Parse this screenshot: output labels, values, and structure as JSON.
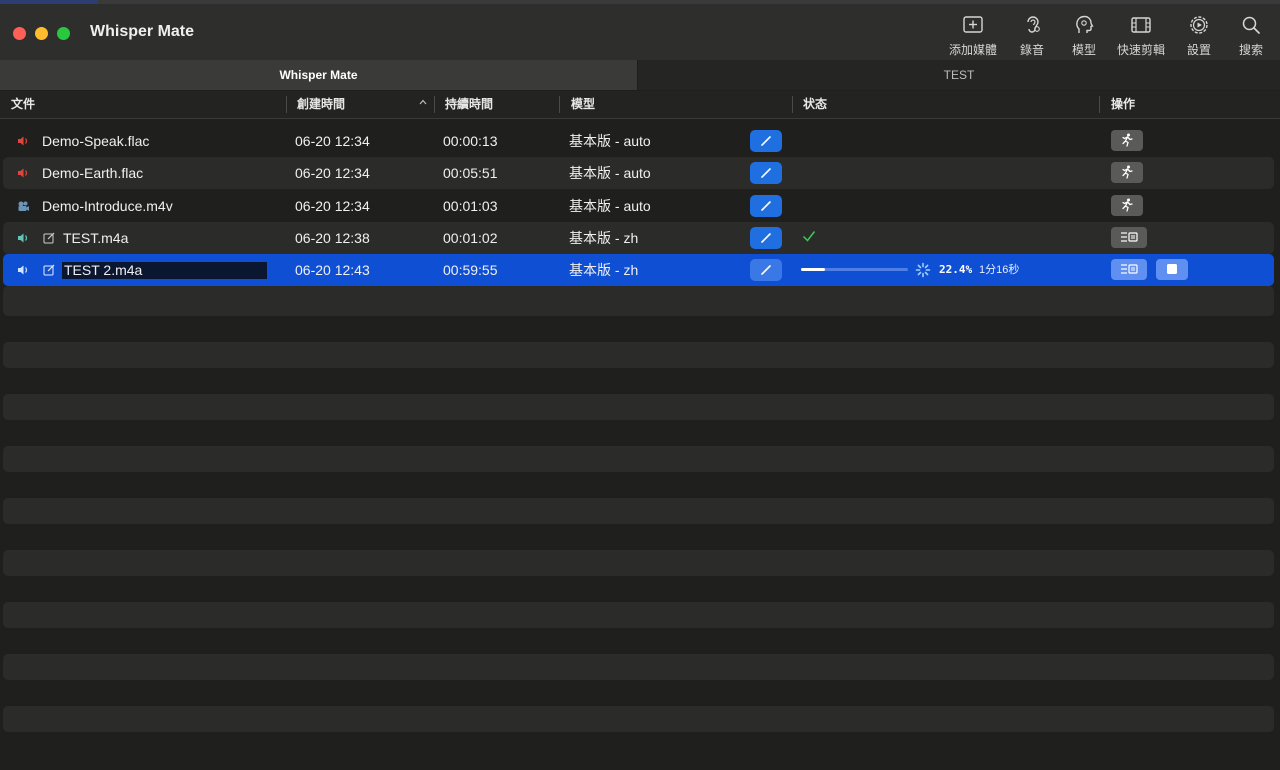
{
  "window": {
    "title": "Whisper Mate"
  },
  "toolbar": {
    "add_media": "添加媒體",
    "record": "錄音",
    "model": "模型",
    "quick_edit": "快速剪輯",
    "settings": "設置",
    "search": "搜索"
  },
  "tabs": [
    {
      "label": "Whisper Mate",
      "active": true
    },
    {
      "label": "TEST",
      "active": false
    }
  ],
  "columns": {
    "file": "文件",
    "created": "創建時間",
    "duration": "持續時間",
    "model": "模型",
    "status": "状态",
    "actions": "操作"
  },
  "rows": [
    {
      "icon": "audio-file-red-icon",
      "editable": false,
      "name": "Demo-Speak.flac",
      "created": "06-20 12:34",
      "duration": "00:00:13",
      "model": "基本版 - auto",
      "status": "",
      "action": "run"
    },
    {
      "icon": "audio-file-red-icon",
      "editable": false,
      "name": "Demo-Earth.flac",
      "created": "06-20 12:34",
      "duration": "00:05:51",
      "model": "基本版 - auto",
      "status": "",
      "action": "run"
    },
    {
      "icon": "video-file-icon",
      "editable": false,
      "name": "Demo-Introduce.m4v",
      "created": "06-20 12:34",
      "duration": "00:01:03",
      "model": "基本版 - auto",
      "status": "",
      "action": "run"
    },
    {
      "icon": "audio-file-teal-icon",
      "editable": true,
      "name": "TEST.m4a",
      "created": "06-20 12:38",
      "duration": "00:01:02",
      "model": "基本版 - zh",
      "status": "done",
      "action": "subtitle"
    },
    {
      "icon": "audio-file-white-icon",
      "editable": true,
      "name": "TEST 2.m4a",
      "created": "06-20 12:43",
      "duration": "00:59:55",
      "model": "基本版 - zh",
      "status": "running",
      "progress_percent": 22.4,
      "progress_label": "22.4%",
      "eta": "1分16秒",
      "action": "subtitle-stop"
    }
  ],
  "colors": {
    "selection": "#0f4fd4",
    "model_button": "#1f6fe0",
    "done_check": "#3ec85a",
    "audio_red": "#e0443e",
    "audio_teal": "#5fc7b7"
  }
}
